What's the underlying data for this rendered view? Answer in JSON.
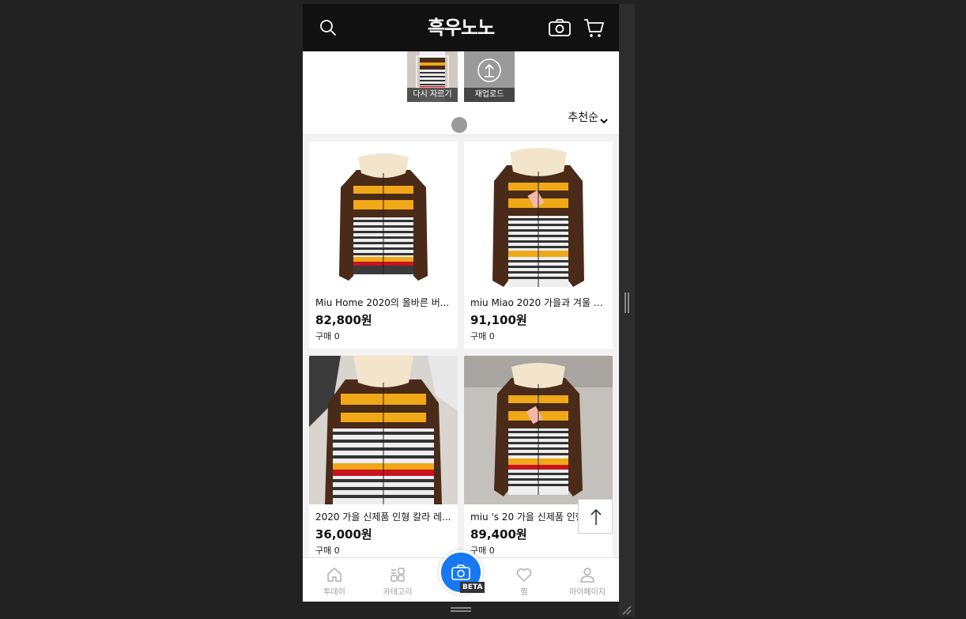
{
  "header": {
    "logo": "흑우노노"
  },
  "crop": {
    "recrop_label": "다시 자르기",
    "reupload_label": "재업로드"
  },
  "sort": {
    "label": "추천순"
  },
  "products": [
    {
      "name": "Miu Home 2020의 올바른 버...",
      "price": "82,800원",
      "purchase": "구매 0",
      "background": "#ffffff"
    },
    {
      "name": "miu Miao 2020 가을과 겨울 줄...",
      "price": "91,100원",
      "purchase": "구매 0",
      "background": "#ffffff"
    },
    {
      "name": "2020 가을 신제품 인형 칼라 레...",
      "price": "36,000원",
      "purchase": "구매 0",
      "background": "#c9c4bf"
    },
    {
      "name": "miu 's 20 가을 신제품 인형 칼...",
      "price": "89,400원",
      "purchase": "구매 0",
      "background": "#b9b4af"
    }
  ],
  "nav": {
    "today": "투데이",
    "category": "카테고리",
    "beta": "BETA",
    "wishlist": "찜",
    "mypage": "마이페이지"
  },
  "colors": {
    "header_bg": "#111111",
    "fab": "#1778f2",
    "sweater_brown": "#4a2a18",
    "sweater_yellow": "#f0a818",
    "sweater_red": "#c8141e",
    "collar": "#f3e4cc"
  }
}
